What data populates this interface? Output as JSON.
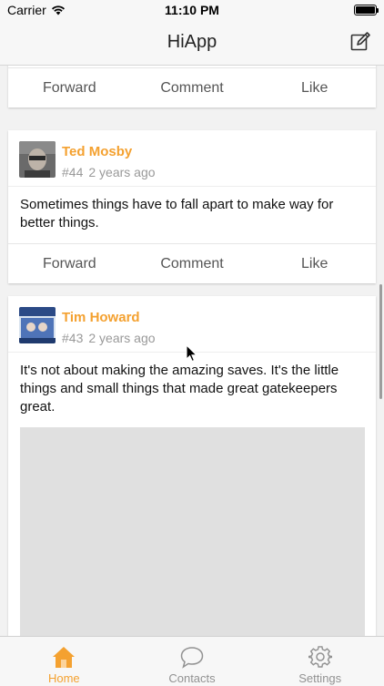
{
  "status_bar": {
    "carrier": "Carrier",
    "time": "11:10 PM"
  },
  "nav": {
    "title": "HiApp",
    "compose_icon": "compose-icon"
  },
  "colors": {
    "accent": "#f4a130",
    "tab_inactive": "#929292"
  },
  "top_card": {
    "actions": [
      "Forward",
      "Comment",
      "Like"
    ]
  },
  "posts": [
    {
      "author": "Ted Mosby",
      "id": "#44",
      "time": "2 years ago",
      "text": "Sometimes things have to fall apart to make way for better things.",
      "actions": [
        "Forward",
        "Comment",
        "Like"
      ]
    },
    {
      "author": "Tim Howard",
      "id": "#43",
      "time": "2 years ago",
      "text": "It's not about making the amazing saves. It's the little things and small things that made great gatekeepers great.",
      "has_image": true
    }
  ],
  "tabs": [
    {
      "label": "Home",
      "icon": "home-icon",
      "active": true
    },
    {
      "label": "Contacts",
      "icon": "chat-bubble-icon",
      "active": false
    },
    {
      "label": "Settings",
      "icon": "gear-icon",
      "active": false
    }
  ]
}
